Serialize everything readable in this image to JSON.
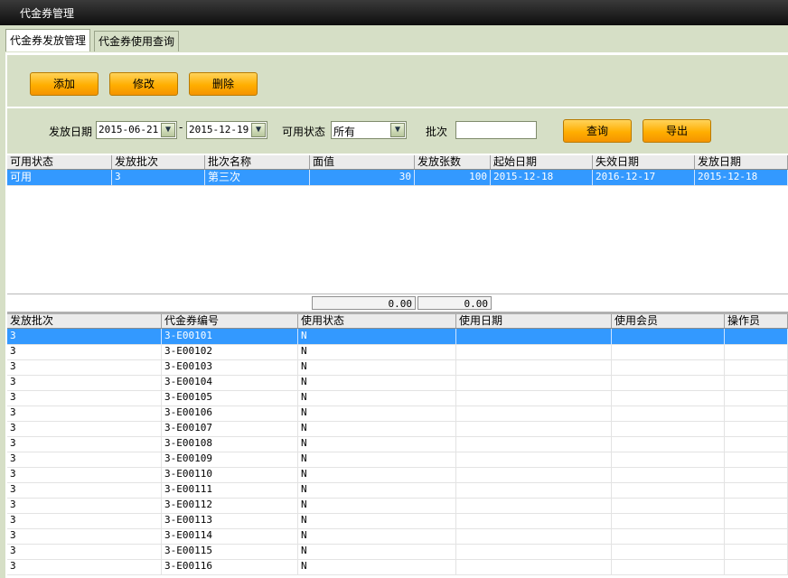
{
  "window": {
    "title": "代金券管理"
  },
  "tabs": [
    {
      "label": "代金券发放管理",
      "active": true
    },
    {
      "label": "代金券使用查询",
      "active": false
    }
  ],
  "toolbar": {
    "add_label": "添加",
    "edit_label": "修改",
    "delete_label": "删除"
  },
  "filter": {
    "date_label": "发放日期",
    "date_from": "2015-06-21",
    "date_sep": "-",
    "date_to": "2015-12-19",
    "status_label": "可用状态",
    "status_value": "所有",
    "batch_label": "批次",
    "batch_value": "",
    "query_label": "查询",
    "export_label": "导出"
  },
  "batch_table": {
    "columns": [
      "可用状态",
      "发放批次",
      "批次名称",
      "面值",
      "发放张数",
      "起始日期",
      "失效日期",
      "发放日期"
    ],
    "rows": [
      [
        "可用",
        "3",
        "第三次",
        "30",
        "100",
        "2015-12-18",
        "2016-12-17",
        "2015-12-18"
      ]
    ],
    "summary": {
      "face_value_total": "0.00",
      "count_total": "0.00"
    }
  },
  "coupon_table": {
    "columns": [
      "发放批次",
      "代金券编号",
      "使用状态",
      "使用日期",
      "使用会员",
      "操作员"
    ],
    "rows": [
      [
        "3",
        "3-E00101",
        "N",
        "",
        "",
        ""
      ],
      [
        "3",
        "3-E00102",
        "N",
        "",
        "",
        ""
      ],
      [
        "3",
        "3-E00103",
        "N",
        "",
        "",
        ""
      ],
      [
        "3",
        "3-E00104",
        "N",
        "",
        "",
        ""
      ],
      [
        "3",
        "3-E00105",
        "N",
        "",
        "",
        ""
      ],
      [
        "3",
        "3-E00106",
        "N",
        "",
        "",
        ""
      ],
      [
        "3",
        "3-E00107",
        "N",
        "",
        "",
        ""
      ],
      [
        "3",
        "3-E00108",
        "N",
        "",
        "",
        ""
      ],
      [
        "3",
        "3-E00109",
        "N",
        "",
        "",
        ""
      ],
      [
        "3",
        "3-E00110",
        "N",
        "",
        "",
        ""
      ],
      [
        "3",
        "3-E00111",
        "N",
        "",
        "",
        ""
      ],
      [
        "3",
        "3-E00112",
        "N",
        "",
        "",
        ""
      ],
      [
        "3",
        "3-E00113",
        "N",
        "",
        "",
        ""
      ],
      [
        "3",
        "3-E00114",
        "N",
        "",
        "",
        ""
      ],
      [
        "3",
        "3-E00115",
        "N",
        "",
        "",
        ""
      ],
      [
        "3",
        "3-E00116",
        "N",
        "",
        "",
        ""
      ]
    ]
  },
  "icons": {
    "dropdown": "chevron-down-icon"
  }
}
